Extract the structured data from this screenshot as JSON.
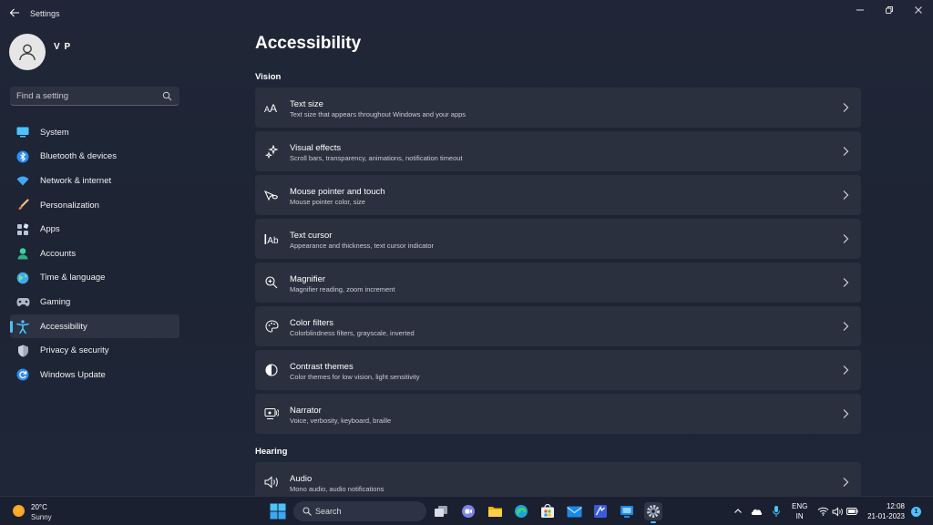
{
  "window": {
    "title": "Settings",
    "controls": [
      "minimize-icon",
      "restore-icon",
      "close-icon"
    ]
  },
  "profile": {
    "name": "V P"
  },
  "search": {
    "placeholder": "Find a setting"
  },
  "sidebar": {
    "items": [
      {
        "label": "System",
        "icon": "system-icon",
        "color": "#4cc2ff"
      },
      {
        "label": "Bluetooth & devices",
        "icon": "bluetooth-icon",
        "color": "#2b8cf0"
      },
      {
        "label": "Network & internet",
        "icon": "wifi-icon",
        "color": "#3fa9f5"
      },
      {
        "label": "Personalization",
        "icon": "brush-icon",
        "color": "#f0a060"
      },
      {
        "label": "Apps",
        "icon": "apps-icon",
        "color": "#b8c4d8"
      },
      {
        "label": "Accounts",
        "icon": "accounts-icon",
        "color": "#3fd0a0"
      },
      {
        "label": "Time & language",
        "icon": "globe-icon",
        "color": "#3fa9f5"
      },
      {
        "label": "Gaming",
        "icon": "gamepad-icon",
        "color": "#b0b8c8"
      },
      {
        "label": "Accessibility",
        "icon": "accessibility-icon",
        "color": "#4cc2ff",
        "active": true
      },
      {
        "label": "Privacy & security",
        "icon": "shield-icon",
        "color": "#a0a8b8"
      },
      {
        "label": "Windows Update",
        "icon": "update-icon",
        "color": "#2b8cf0"
      }
    ]
  },
  "main": {
    "title": "Accessibility",
    "sections": [
      {
        "title": "Vision",
        "items": [
          {
            "title": "Text size",
            "subtitle": "Text size that appears throughout Windows and your apps",
            "icon": "text-size-icon"
          },
          {
            "title": "Visual effects",
            "subtitle": "Scroll bars, transparency, animations, notification timeout",
            "icon": "sparkle-icon"
          },
          {
            "title": "Mouse pointer and touch",
            "subtitle": "Mouse pointer color, size",
            "icon": "mouse-pointer-icon"
          },
          {
            "title": "Text cursor",
            "subtitle": "Appearance and thickness, text cursor indicator",
            "icon": "text-cursor-icon"
          },
          {
            "title": "Magnifier",
            "subtitle": "Magnifier reading, zoom increment",
            "icon": "magnifier-icon"
          },
          {
            "title": "Color filters",
            "subtitle": "Colorblindness filters, grayscale, inverted",
            "icon": "palette-icon"
          },
          {
            "title": "Contrast themes",
            "subtitle": "Color themes for low vision, light sensitivity",
            "icon": "contrast-icon"
          },
          {
            "title": "Narrator",
            "subtitle": "Voice, verbosity, keyboard, braille",
            "icon": "narrator-icon"
          }
        ]
      },
      {
        "title": "Hearing",
        "items": [
          {
            "title": "Audio",
            "subtitle": "Mono audio, audio notifications",
            "icon": "speaker-icon"
          }
        ]
      }
    ]
  },
  "taskbar": {
    "weather": {
      "temp": "20°C",
      "desc": "Sunny"
    },
    "search_label": "Search",
    "apps": [
      "task-view-icon",
      "teams-chat-icon",
      "file-explorer-icon",
      "edge-icon",
      "store-icon",
      "mail-icon",
      "photo-editor-icon",
      "remote-desktop-icon",
      "settings-icon"
    ],
    "lang_line1": "ENG",
    "lang_line2": "IN",
    "time": "12:08",
    "date": "21-01-2023",
    "notifications": "1"
  }
}
